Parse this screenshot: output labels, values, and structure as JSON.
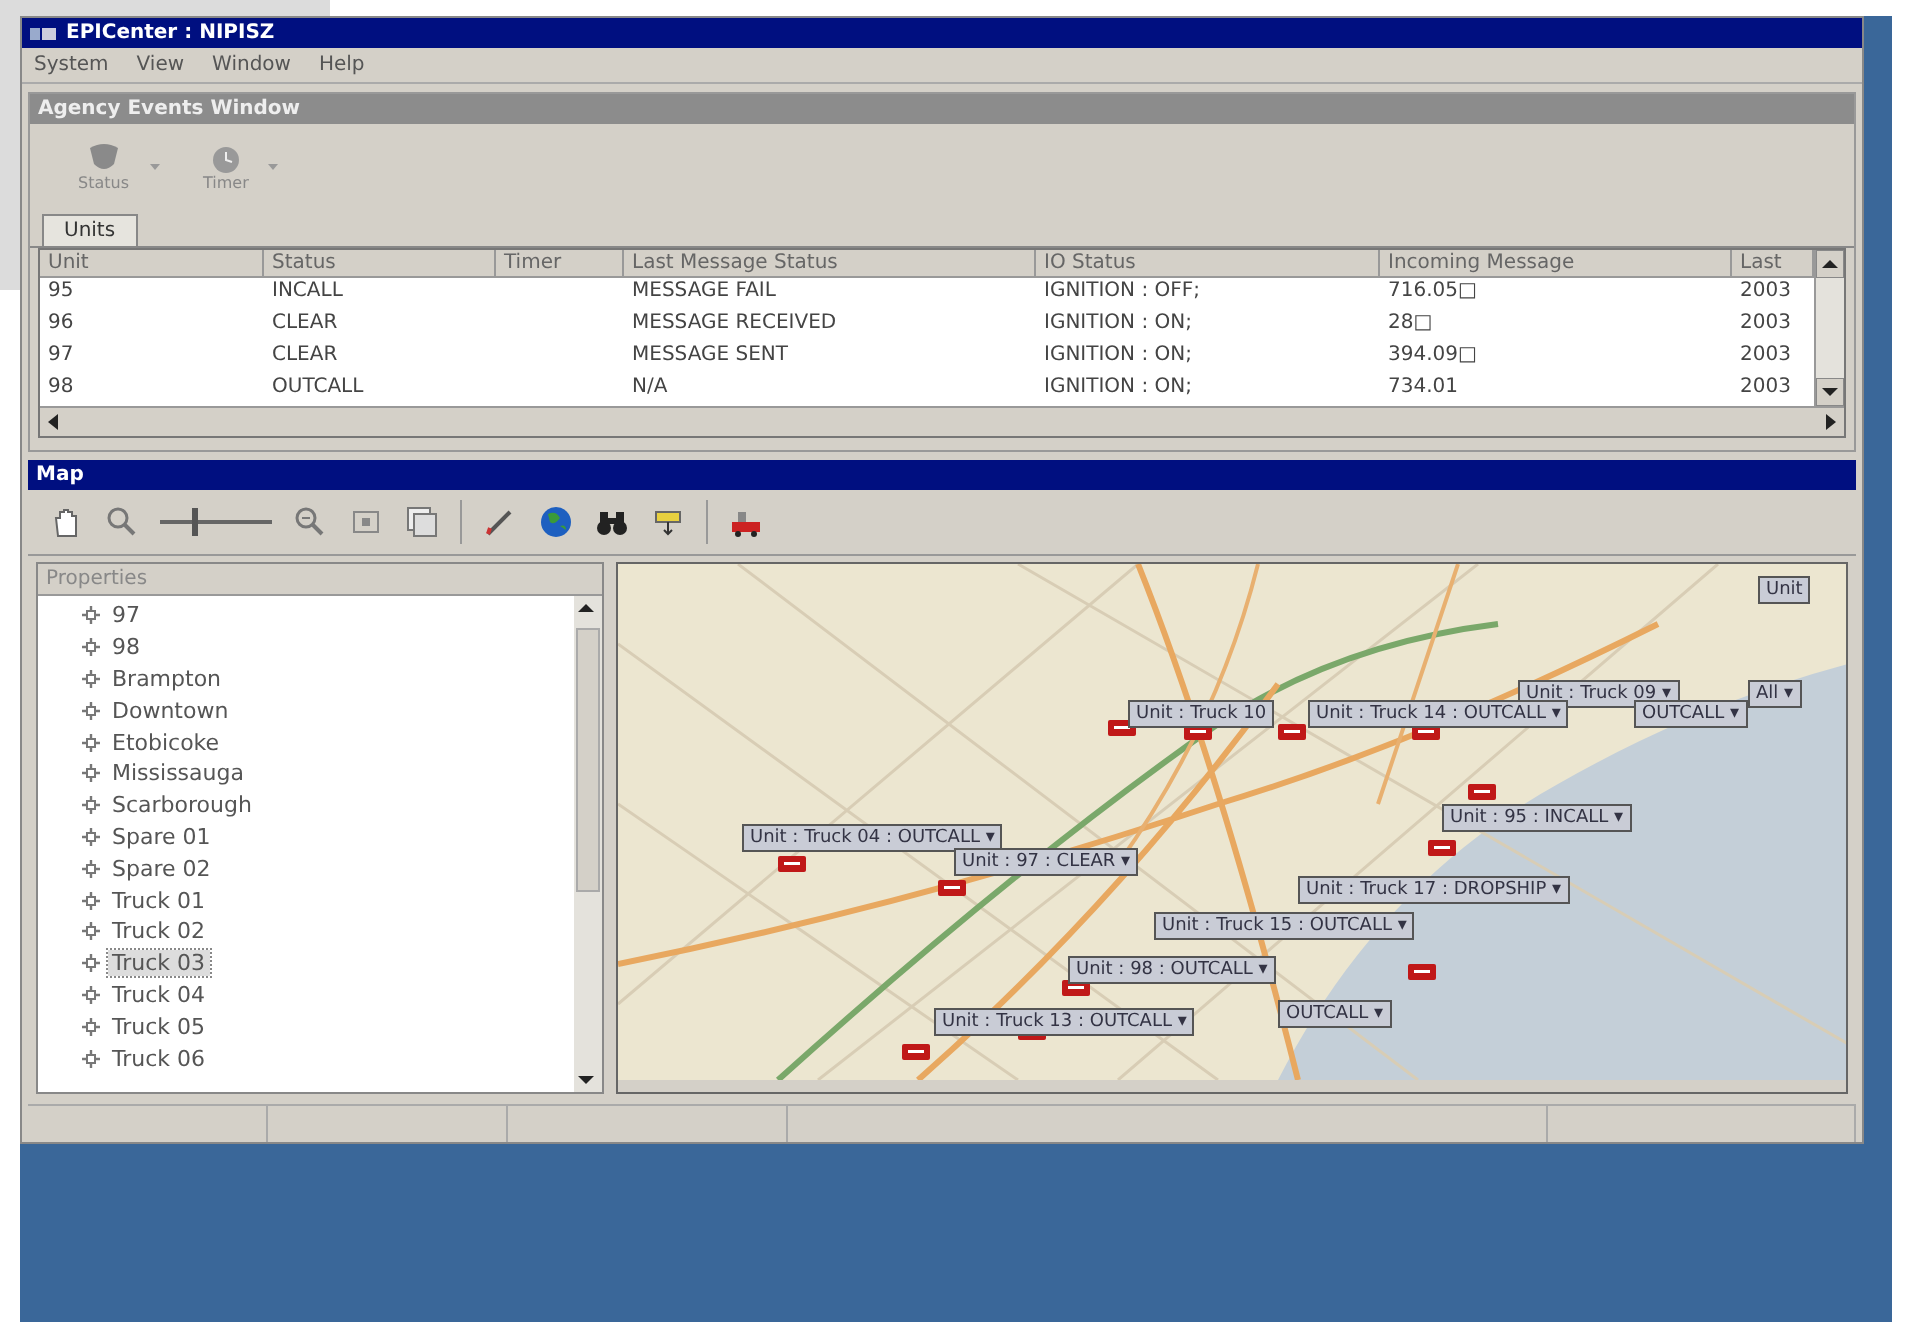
{
  "window": {
    "title": "EPICenter : NIPISZ"
  },
  "menu": [
    "System",
    "View",
    "Window",
    "Help"
  ],
  "events_window": {
    "title": "Agency Events Window",
    "toolbar": [
      {
        "label": "Status",
        "kind": "status"
      },
      {
        "label": "Timer",
        "kind": "timer"
      }
    ],
    "tabs": [
      {
        "label": "Units",
        "selected": true
      }
    ],
    "table": {
      "columns": [
        "Unit",
        "Status",
        "Timer",
        "Last Message Status",
        "IO Status",
        "Incoming Message",
        "Last"
      ],
      "rows": [
        {
          "unit": "95",
          "status": "INCALL",
          "last_message_status": "MESSAGE FAIL",
          "io_status": "IGNITION : OFF;",
          "incoming_message": "716.05□",
          "last": "2003"
        },
        {
          "unit": "96",
          "status": "CLEAR",
          "last_message_status": "MESSAGE RECEIVED",
          "io_status": "IGNITION : ON;",
          "incoming_message": "28□",
          "last": "2003"
        },
        {
          "unit": "97",
          "status": "CLEAR",
          "last_message_status": "MESSAGE SENT",
          "io_status": "IGNITION : ON;",
          "incoming_message": "394.09□",
          "last": "2003"
        },
        {
          "unit": "98",
          "status": "OUTCALL",
          "last_message_status": "N/A",
          "io_status": "IGNITION : ON;",
          "incoming_message": "734.01",
          "last": "2003"
        }
      ]
    }
  },
  "map": {
    "title": "Map",
    "zoom_slider": {
      "level": 0.3
    },
    "tree": {
      "header": "Properties",
      "items": [
        {
          "label": "97",
          "selected": false
        },
        {
          "label": "98",
          "selected": false
        },
        {
          "label": "Brampton",
          "selected": false
        },
        {
          "label": "Downtown",
          "selected": false
        },
        {
          "label": "Etobicoke",
          "selected": false
        },
        {
          "label": "Mississauga",
          "selected": false
        },
        {
          "label": "Scarborough",
          "selected": false
        },
        {
          "label": "Spare 01",
          "selected": false
        },
        {
          "label": "Spare 02",
          "selected": false
        },
        {
          "label": "Truck 01",
          "selected": false
        },
        {
          "label": "Truck 02",
          "selected": false
        },
        {
          "label": "Truck 03",
          "selected": true
        },
        {
          "label": "Truck 04",
          "selected": false
        },
        {
          "label": "Truck 05",
          "selected": false
        },
        {
          "label": "Truck 06",
          "selected": false
        }
      ]
    },
    "unit_labels": [
      {
        "text": "Unit"
      },
      {
        "text": "Unit : Truck 09 ▾"
      },
      {
        "text": "All ▾"
      },
      {
        "text": "Unit : Truck 10"
      },
      {
        "text": "Unit : Truck 14 : OUTCALL ▾"
      },
      {
        "text": "OUTCALL ▾"
      },
      {
        "text": "Unit : Truck 04 : OUTCALL ▾"
      },
      {
        "text": "Unit : 97 : CLEAR ▾"
      },
      {
        "text": "Unit : 95 : INCALL ▾"
      },
      {
        "text": "Unit : Truck 17 : DROPSHIP ▾"
      },
      {
        "text": "Unit : Truck 15 : OUTCALL ▾"
      },
      {
        "text": "Unit : 98 : OUTCALL ▾"
      },
      {
        "text": "Unit : Truck 13 : OUTCALL ▾"
      },
      {
        "text": "OUTCALL ▾"
      }
    ]
  }
}
